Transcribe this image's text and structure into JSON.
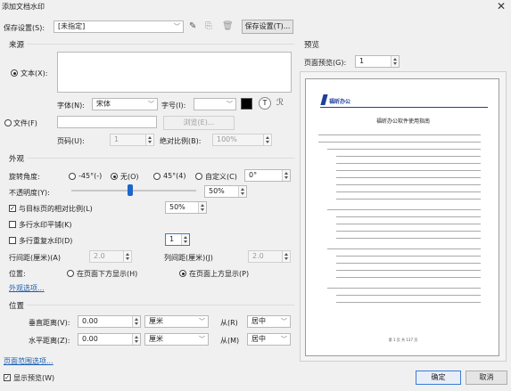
{
  "window": {
    "title": "添加文档水印",
    "close": "✕"
  },
  "presets": {
    "label": "保存设置(S):",
    "value": "[未指定]",
    "save_button": "保存设置(T)..."
  },
  "source": {
    "group_title": "来源",
    "text_option": "文本(X):",
    "font_label": "字体(N):",
    "font_value": "宋体",
    "size_label": "字号(I):",
    "file_option": "文件(F)",
    "browse_button": "浏览(E)...",
    "page_label": "页码(U):",
    "page_value": "1",
    "scale_label": "绝对比例(B):",
    "scale_value": "100%"
  },
  "appearance": {
    "group_title": "外观",
    "rotation_label": "旋转角度:",
    "rot_neg45": "-45°(-)",
    "rot_none": "无(O)",
    "rot_45": "45°(4)",
    "rot_custom": "自定义(C)",
    "rot_custom_value": "0°",
    "opacity_label": "不透明度(Y):",
    "opacity_value": "50%",
    "opacity_fraction": 0.5,
    "relative_scale_label": "与目标页的相对比例(L)",
    "relative_scale_value": "50%",
    "tile_label": "多行水印平铺(K)",
    "repeat_label": "多行重复水印(D)",
    "repeat_value": "1",
    "row_spacing_label": "行间距(厘米)(A)",
    "row_spacing_value": "2.0",
    "col_spacing_label": "列间距(厘米)(J)",
    "col_spacing_value": "2.0",
    "position_label": "位置:",
    "pos_below": "在页面下方显示(H)",
    "pos_above": "在页面上方显示(P)",
    "options_link": "外观选项..."
  },
  "position": {
    "group_title": "位置",
    "vertical_label": "垂直距离(V):",
    "vertical_value": "0.00",
    "vertical_unit": "厘米",
    "vertical_from_label": "从(R)",
    "vertical_from_value": "居中",
    "horizontal_label": "水平距离(Z):",
    "horizontal_value": "0.00",
    "horizontal_unit": "厘米",
    "horizontal_from_label": "从(M)",
    "horizontal_from_value": "居中"
  },
  "preview": {
    "group_title": "预览",
    "page_label": "页面预览(G):",
    "page_value": "1",
    "doc_logo": "福昕办公",
    "doc_title": "福昕办公软件使用指南",
    "doc_footer": "第 1 页 共 137 页"
  },
  "footer": {
    "page_range_link": "页面范围选项...",
    "show_preview": "显示预览(W)",
    "ok_button": "确定",
    "cancel_button": "取消"
  },
  "colors": {
    "accent": "#3a7bd5",
    "slider_thumb": "#1e66c9",
    "logo_blue": "#1f3f9a"
  }
}
